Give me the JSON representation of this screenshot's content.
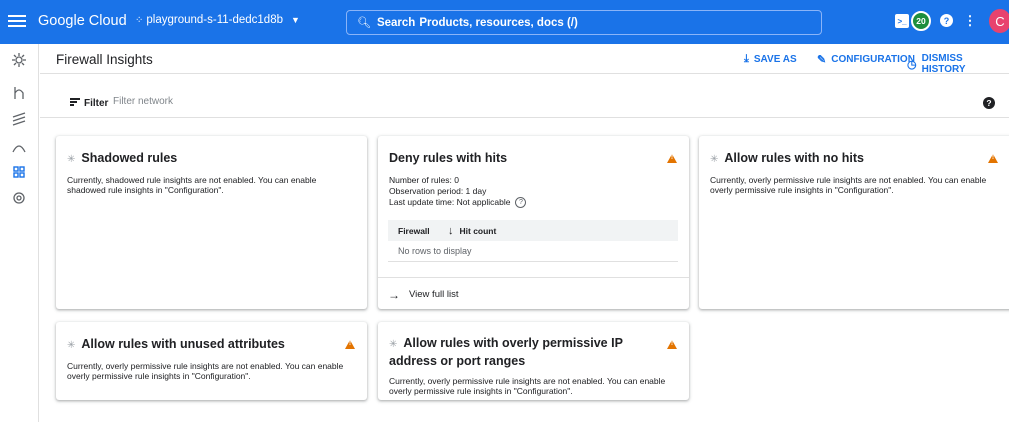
{
  "topbar": {
    "brand": "Google Cloud",
    "project": "playground-s-11-dedc1d8b",
    "search_label": "Search",
    "search_text": "Products, resources, docs (/)",
    "badge_count": "20",
    "avatar_letter": "C",
    "colors": {
      "bar": "#1a73e8",
      "badge": "#1e8e3e",
      "avatar": "#e8436e"
    }
  },
  "header": {
    "title": "Firewall Insights",
    "save_as": "SAVE AS",
    "configuration": "CONFIGURATION",
    "dismiss_history": "DISMISS HISTORY"
  },
  "filter": {
    "label": "Filter",
    "placeholder": "Filter network"
  },
  "cards": {
    "shadowed": {
      "title": "Shadowed rules",
      "body": "Currently, shadowed rule insights are not enabled. You can enable shadowed rule insights in \"Configuration\"."
    },
    "deny": {
      "title": "Deny rules with hits",
      "rules": "Number of rules: 0",
      "period": "Observation period: 1 day",
      "update": "Last update time: Not applicable",
      "col_firewall": "Firewall",
      "col_hits": "Hit count",
      "empty": "No rows to display",
      "view_full": "View full list"
    },
    "allow_no_hits": {
      "title": "Allow rules with no hits",
      "body": "Currently, overly permissive rule insights are not enabled. You can enable overly permissive rule insights in \"Configuration\"."
    },
    "unused_attrs": {
      "title": "Allow rules with unused attributes",
      "body": "Currently, overly permissive rule insights are not enabled. You can enable overly permissive rule insights in \"Configuration\"."
    },
    "overly_permissive": {
      "title": "Allow rules with overly permissive IP address or port ranges",
      "body": "Currently, overly permissive rule insights are not enabled. You can enable overly permissive rule insights in \"Configuration\"."
    }
  },
  "icons": {
    "warning_color": "#e37400",
    "link_color": "#1a73e8"
  }
}
